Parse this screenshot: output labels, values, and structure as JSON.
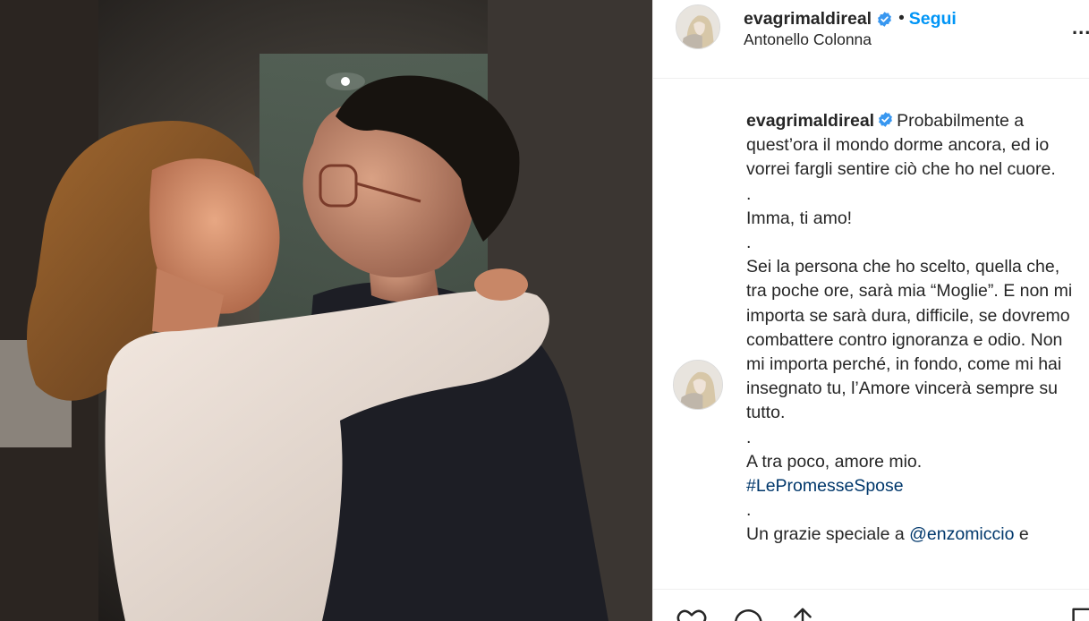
{
  "post": {
    "photo_alt": "Two women embracing and smiling"
  },
  "header": {
    "username": "evagrimaldireal",
    "separator": "•",
    "follow_label": "Segui",
    "location": "Antonello Colonna",
    "more_label": "...",
    "verified_icon": "verified-badge-icon"
  },
  "caption": {
    "username": "evagrimaldireal",
    "lines": [
      "Probabilmente a quest’ora il mondo dorme ancora, ed io vorrei fargli sentire ciò che ho nel cuore.",
      ".",
      "Imma, ti amo!",
      ".",
      "Sei la persona che ho scelto, quella che, tra poche ore, sarà mia “Moglie”. E non mi importa se sarà dura, difficile, se dovremo combattere contro ignoranza e odio. Non mi importa perché, in fondo, come mi hai insegnato tu, l’Amore vincerà sempre su tutto.",
      ".",
      "A tra poco, amore mio."
    ],
    "hashtag": "#LePromesseSpose",
    "dot_after_hashtag": ".",
    "thanks_prefix": "Un grazie speciale a ",
    "mention": "@enzomiccio",
    "thanks_suffix": " e"
  },
  "actions": {
    "icons": [
      "heart-icon",
      "comment-icon",
      "share-icon",
      "bookmark-icon"
    ]
  },
  "colors": {
    "link_blue": "#0095f6",
    "hashtag_blue": "#00376b",
    "text": "#262626",
    "border": "#efefef"
  }
}
